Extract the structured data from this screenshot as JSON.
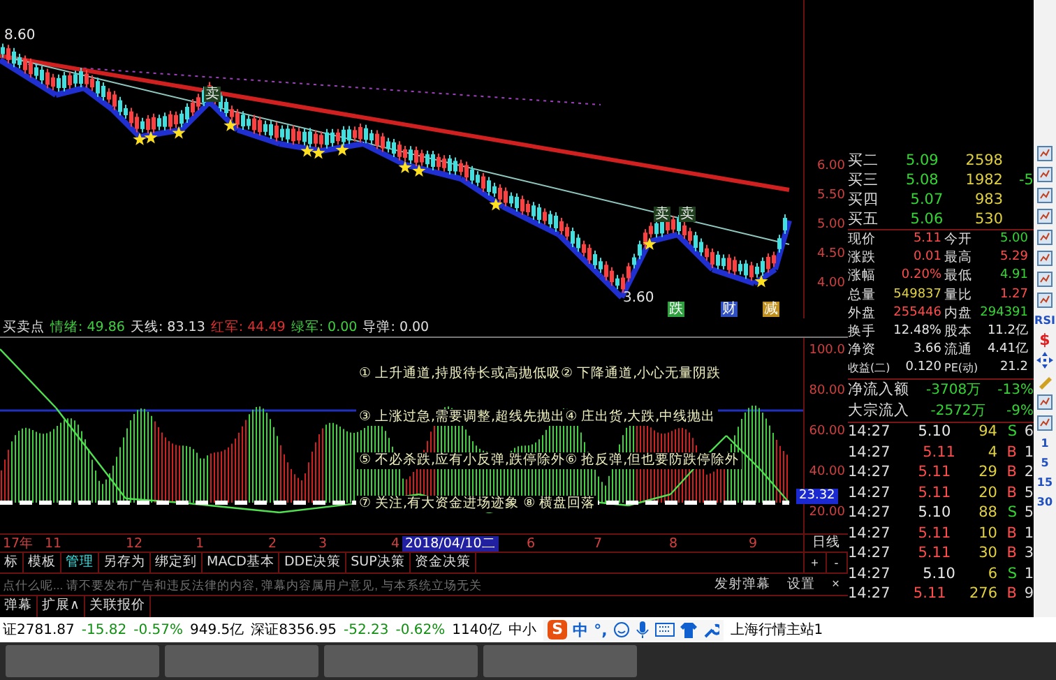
{
  "chart_marks": [
    {
      "text": "8.60",
      "kind": "price"
    },
    {
      "text": "3.60",
      "kind": "price"
    },
    {
      "text": "卖",
      "kind": "sell"
    },
    {
      "text": "卖",
      "kind": "sell"
    },
    {
      "text": "卖",
      "kind": "sell"
    },
    {
      "text": "跌",
      "kind": "tag",
      "color": "#30a040"
    },
    {
      "text": "财",
      "kind": "tag",
      "color": "#3050c0"
    },
    {
      "text": "减",
      "kind": "tag",
      "color": "#c09020"
    }
  ],
  "price_axis": [
    "6.00",
    "5.50",
    "5.00",
    "4.50",
    "4.00"
  ],
  "indicator": {
    "name": "买卖点",
    "values": [
      {
        "label": "情绪:",
        "value": "49.86",
        "color": "#40d040"
      },
      {
        "label": "天线:",
        "value": "83.13",
        "color": "#e0e0e0"
      },
      {
        "label": "红军:",
        "value": "44.49",
        "color": "#e03030"
      },
      {
        "label": "绿军:",
        "value": "0.00",
        "color": "#40d040"
      },
      {
        "label": "导弹:",
        "value": "0.00",
        "color": "#e0e0e0"
      }
    ]
  },
  "notes": [
    "① 上升通道,持股待长或高抛低吸② 下降通道,小心无量阴跌",
    "③ 上涨过急,需要调整,超线先抛出④ 庄出货,大跌,中线抛出",
    "⑤ 不必杀跌,应有小反弹,跌停除外⑥ 抢反弹,但也要防跌停除外",
    "⑦ 关注,有大资金进场迹象 ⑧ 横盘回落"
  ],
  "indicator_axis": [
    "100.0",
    "80.00",
    "60.00",
    "40.00",
    "20.00"
  ],
  "indicator_current": "23.32",
  "date_axis": [
    {
      "label": "17年",
      "selected": false
    },
    {
      "label": "11",
      "selected": false
    },
    {
      "label": "12",
      "selected": false
    },
    {
      "label": "1",
      "selected": false
    },
    {
      "label": "2",
      "selected": false
    },
    {
      "label": "3",
      "selected": false
    },
    {
      "label": "4",
      "selected": false
    },
    {
      "label": "2018/04/10二",
      "selected": true
    },
    {
      "label": "6",
      "selected": false
    },
    {
      "label": "7",
      "selected": false
    },
    {
      "label": "8",
      "selected": false
    },
    {
      "label": "9",
      "selected": false
    }
  ],
  "period": "日线",
  "zoom_buttons": [
    "+",
    "-"
  ],
  "tabs": [
    {
      "label": "标",
      "selected": false
    },
    {
      "label": "模板",
      "selected": false
    },
    {
      "label": "管理",
      "selected": true
    },
    {
      "label": "另存为",
      "selected": false
    },
    {
      "label": "绑定到",
      "selected": false
    },
    {
      "label": "MACD基本",
      "selected": false
    },
    {
      "label": "DDE决策",
      "selected": false
    },
    {
      "label": "SUP决策",
      "selected": false
    },
    {
      "label": "资金决策",
      "selected": false
    }
  ],
  "danmu": {
    "placeholder": "点什么呢... 请不要发布广告和违反法律的内容, 弹幕内容属用户意见, 与本系统立场无关",
    "send": "发射弹幕",
    "settings": "设置",
    "close": "×"
  },
  "bottom_tabs": [
    "弹幕",
    "扩展∧",
    "关联报价"
  ],
  "bids": [
    {
      "label": "买二",
      "price": "5.09",
      "volume": "2598"
    },
    {
      "label": "买三",
      "price": "5.08",
      "volume": "1982",
      "extra": "-5"
    },
    {
      "label": "买四",
      "price": "5.07",
      "volume": "983"
    },
    {
      "label": "买五",
      "price": "5.06",
      "volume": "530"
    }
  ],
  "stats": [
    {
      "label": "现价",
      "value": "5.11",
      "color": "#ff4c4c"
    },
    {
      "label": "今开",
      "value": "5.00",
      "color": "#33d633"
    },
    {
      "label": "涨跌",
      "value": "0.01",
      "color": "#ff4c4c"
    },
    {
      "label": "最高",
      "value": "5.29",
      "color": "#ff4c4c"
    },
    {
      "label": "涨幅",
      "value": "0.20%",
      "color": "#ff4c4c"
    },
    {
      "label": "最低",
      "value": "4.91",
      "color": "#33d633"
    },
    {
      "label": "总量",
      "value": "549837",
      "color": "#e0d040"
    },
    {
      "label": "量比",
      "value": "1.27",
      "color": "#ff4c4c"
    },
    {
      "label": "外盘",
      "value": "255446",
      "color": "#ff4c4c"
    },
    {
      "label": "内盘",
      "value": "294391",
      "color": "#33d633"
    },
    {
      "label": "换手",
      "value": "12.48%",
      "color": "#e8e8e8"
    },
    {
      "label": "股本",
      "value": "11.2亿",
      "color": "#e8e8e8"
    },
    {
      "label": "净资",
      "value": "3.66",
      "color": "#e8e8e8"
    },
    {
      "label": "流通",
      "value": "4.41亿",
      "color": "#e8e8e8"
    },
    {
      "label": "收益(二)",
      "value": "0.120",
      "color": "#e8e8e8"
    },
    {
      "label": "PE(动)",
      "value": "21.2",
      "color": "#e8e8e8"
    }
  ],
  "flows": [
    {
      "label": "净流入额",
      "amount": "-3708万",
      "percent": "-13%"
    },
    {
      "label": "大宗流入",
      "amount": "-2572万",
      "percent": "-9%"
    }
  ],
  "trades": [
    {
      "time": "14:27",
      "price": "5.10",
      "color": "#e8e8e8",
      "volume": "94",
      "side": "S",
      "extra": "6"
    },
    {
      "time": "14:27",
      "price": "5.11",
      "color": "#ff4c4c",
      "volume": "4",
      "side": "B",
      "extra": "1"
    },
    {
      "time": "14:27",
      "price": "5.11",
      "color": "#ff4c4c",
      "volume": "29",
      "side": "B",
      "extra": "2"
    },
    {
      "time": "14:27",
      "price": "5.11",
      "color": "#ff4c4c",
      "volume": "20",
      "side": "B",
      "extra": "5"
    },
    {
      "time": "14:27",
      "price": "5.10",
      "color": "#e8e8e8",
      "volume": "88",
      "side": "S",
      "extra": "5"
    },
    {
      "time": "14:27",
      "price": "5.11",
      "color": "#ff4c4c",
      "volume": "10",
      "side": "B",
      "extra": "1"
    },
    {
      "time": "14:27",
      "price": "5.11",
      "color": "#ff4c4c",
      "volume": "30",
      "side": "B",
      "extra": "3"
    },
    {
      "time": "14:27",
      "price": "5.10",
      "color": "#e8e8e8",
      "volume": "6",
      "side": "S",
      "extra": "1"
    },
    {
      "time": "14:27",
      "price": "5.11",
      "color": "#ff4c4c",
      "volume": "276",
      "side": "B",
      "extra": "9"
    }
  ],
  "side_tools": [
    {
      "kind": "icon"
    },
    {
      "kind": "icon"
    },
    {
      "kind": "icon"
    },
    {
      "kind": "icon"
    },
    {
      "kind": "icon"
    },
    {
      "kind": "icon"
    },
    {
      "kind": "icon"
    },
    {
      "kind": "icon"
    },
    {
      "kind": "text",
      "text": "RSI"
    },
    {
      "kind": "dollar",
      "text": "$"
    },
    {
      "kind": "move"
    },
    {
      "kind": "pen"
    },
    {
      "kind": "icon"
    },
    {
      "kind": "icon"
    },
    {
      "kind": "text",
      "text": "1"
    },
    {
      "kind": "text",
      "text": "5"
    },
    {
      "kind": "text",
      "text": "15"
    },
    {
      "kind": "text",
      "text": "30"
    }
  ],
  "status": [
    {
      "text": "证2781.87",
      "color": "#000000"
    },
    {
      "text": "-15.82",
      "color": "#109010"
    },
    {
      "text": "-0.57%",
      "color": "#109010"
    },
    {
      "text": "949.5亿",
      "color": "#000000"
    },
    {
      "text": "深证8356.95",
      "color": "#000000"
    },
    {
      "text": "-52.23",
      "color": "#109010"
    },
    {
      "text": "-0.62%",
      "color": "#109010"
    },
    {
      "text": "1140亿",
      "color": "#000000"
    },
    {
      "text": "中小",
      "color": "#000000"
    }
  ],
  "ime": {
    "logo": "S",
    "mode": "中",
    "punct": "°,"
  },
  "server": "上海行情主站1"
}
